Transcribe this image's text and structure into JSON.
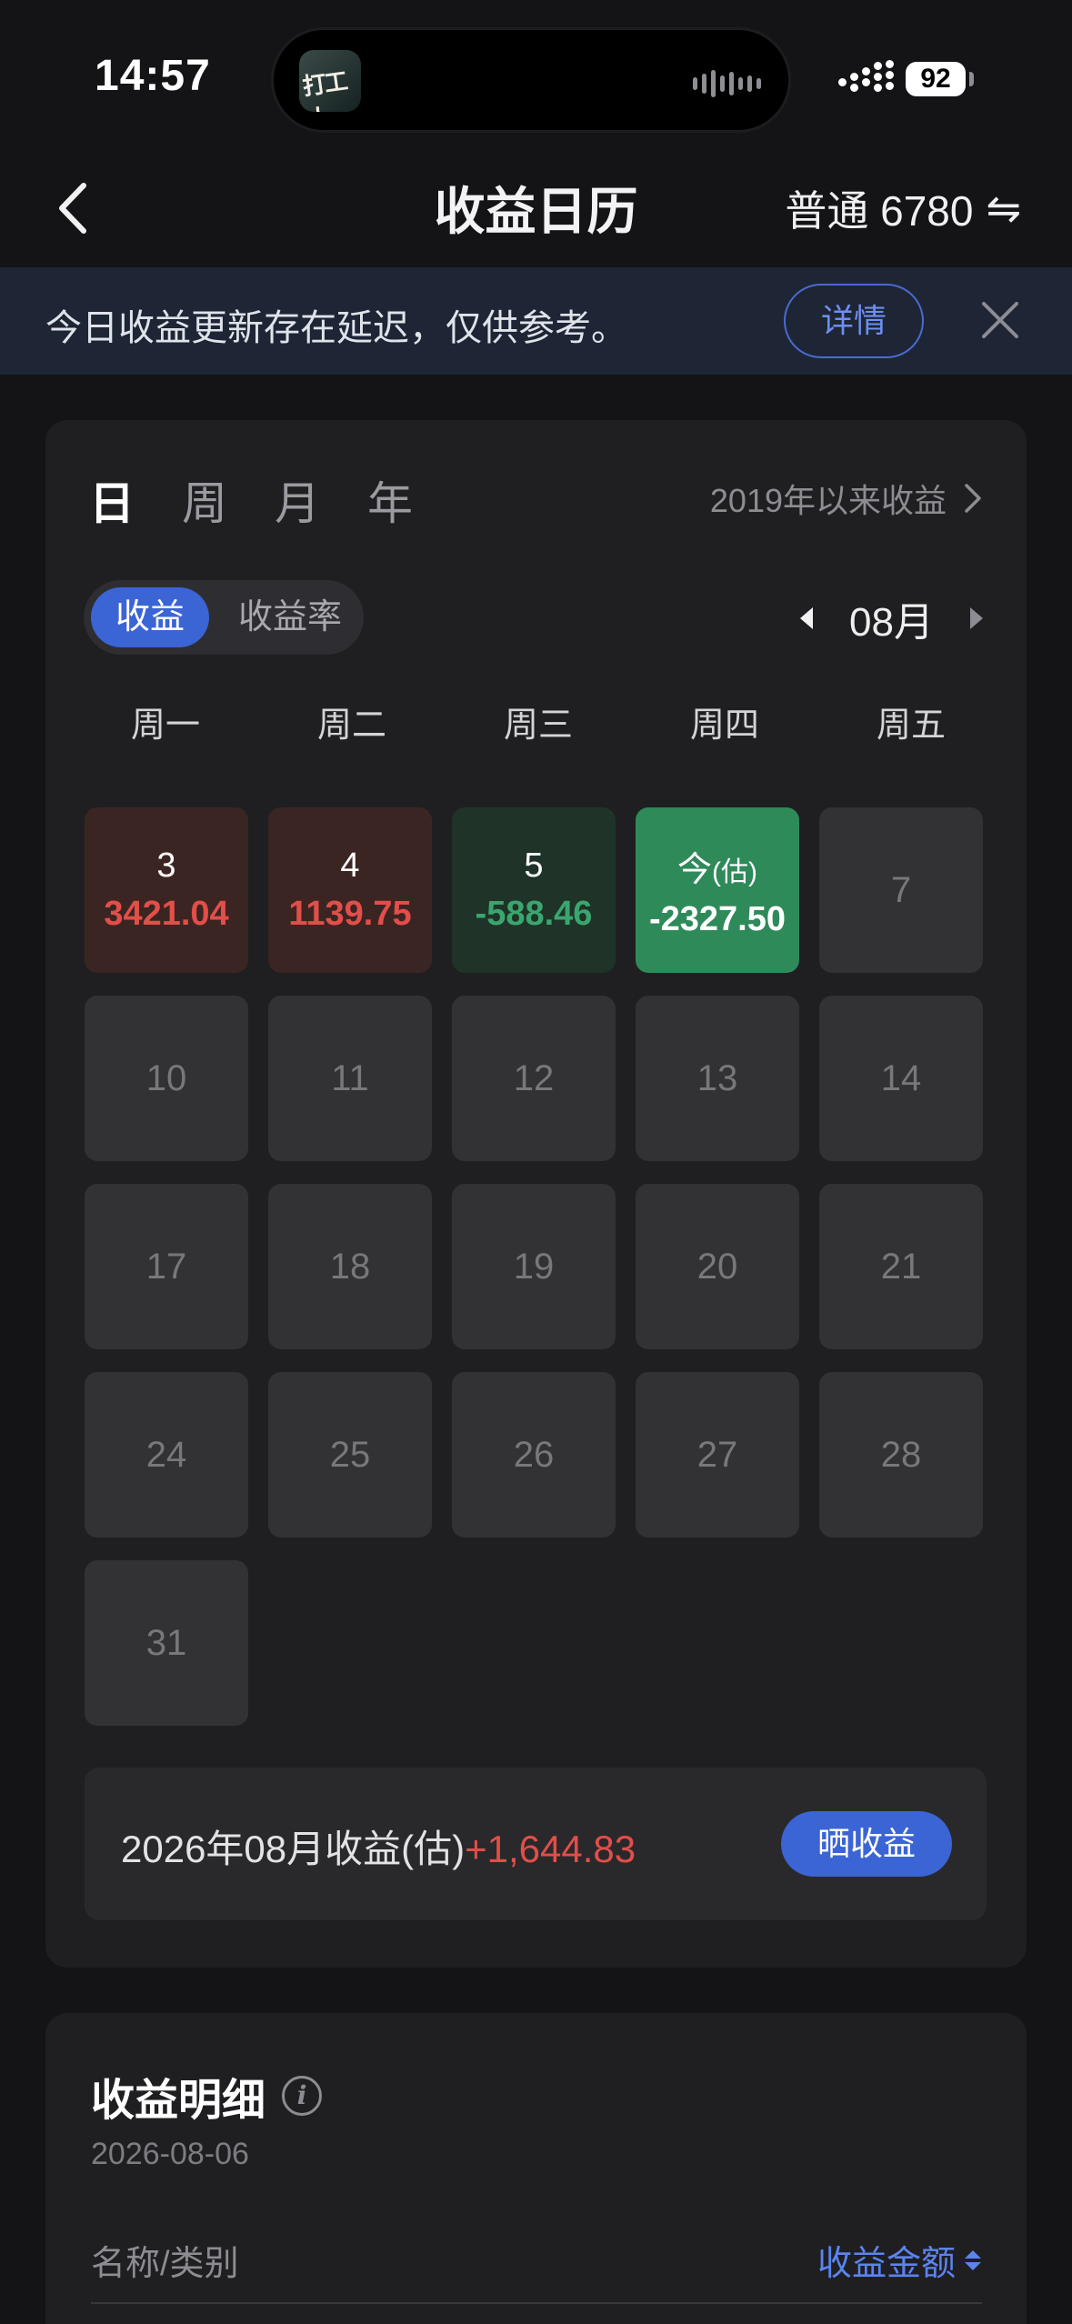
{
  "status_bar": {
    "time": "14:57",
    "battery": "92",
    "island_app_label": "打工人"
  },
  "nav": {
    "title": "收益日历",
    "account": "普通 6780",
    "switch_icon": "⇋"
  },
  "banner": {
    "text": "今日收益更新存在延迟，仅供参考。",
    "detail_label": "详情"
  },
  "calendar": {
    "period_tabs": [
      "日",
      "周",
      "月",
      "年"
    ],
    "active_period": "日",
    "since_label": "2019年以来收益",
    "toggle": {
      "selected": "收益",
      "other": "收益率"
    },
    "month": "08月",
    "weekdays": [
      "周一",
      "周二",
      "周三",
      "周四",
      "周五"
    ],
    "days": [
      {
        "day": "3",
        "amount": "3421.04",
        "state": "up"
      },
      {
        "day": "4",
        "amount": "1139.75",
        "state": "up"
      },
      {
        "day": "5",
        "amount": "-588.46",
        "state": "down"
      },
      {
        "day": "今",
        "est": "(估)",
        "amount": "-2327.50",
        "state": "today"
      },
      {
        "day": "7"
      },
      {
        "day": "10"
      },
      {
        "day": "11"
      },
      {
        "day": "12"
      },
      {
        "day": "13"
      },
      {
        "day": "14"
      },
      {
        "day": "17"
      },
      {
        "day": "18"
      },
      {
        "day": "19"
      },
      {
        "day": "20"
      },
      {
        "day": "21"
      },
      {
        "day": "24"
      },
      {
        "day": "25"
      },
      {
        "day": "26"
      },
      {
        "day": "27"
      },
      {
        "day": "28"
      },
      {
        "day": "31"
      }
    ],
    "summary_label": "2026年08月收益(估)",
    "summary_value": "+1,644.83",
    "share_label": "晒收益"
  },
  "detail": {
    "title": "收益明细",
    "info_icon": "i",
    "date": "2026-08-06",
    "col_name": "名称/类别",
    "col_amount": "收益金额"
  },
  "colors": {
    "accent": "#3b64d4",
    "gain": "#e24e49",
    "loss": "#3aa66e",
    "today": "#2f8a5a"
  }
}
